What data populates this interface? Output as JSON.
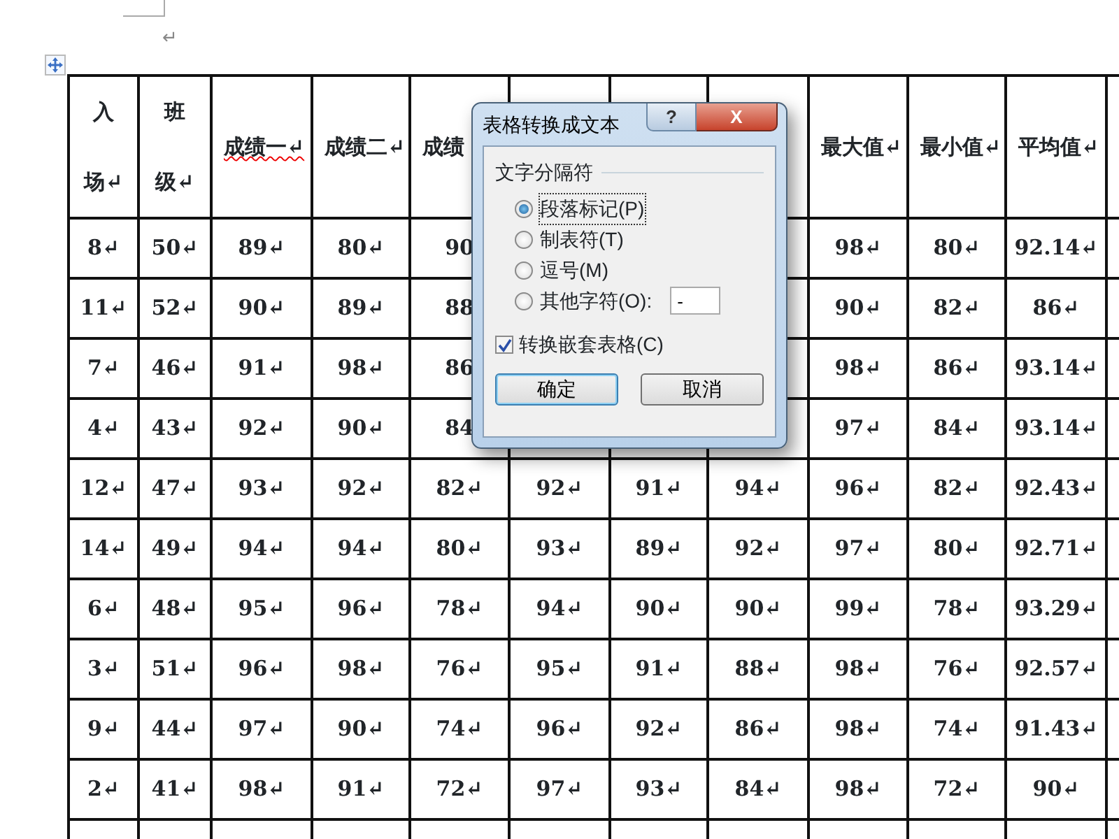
{
  "document": {
    "paragraph_mark": "↵"
  },
  "table": {
    "columns": [
      {
        "label_top": "入",
        "label_bottom": "场↵"
      },
      {
        "label_top": "班",
        "label_bottom": "级↵"
      },
      {
        "label": "成绩一↵",
        "spelling_error": true
      },
      {
        "label": "成绩二↵",
        "spelling_error": false
      },
      {
        "label": "成绩",
        "spelling_error": false
      },
      {},
      {},
      {},
      {
        "label": "最大值↵",
        "spelling_error": false
      },
      {
        "label": "最小值↵",
        "spelling_error": false
      },
      {
        "label": "平均值↵",
        "spelling_error": false
      }
    ],
    "rows": [
      [
        "8↵",
        "50↵",
        "89↵",
        "80↵",
        "90",
        null,
        null,
        null,
        "98↵",
        "80↵",
        "92.14↵"
      ],
      [
        "11↵",
        "52↵",
        "90↵",
        "89↵",
        "88",
        null,
        null,
        null,
        "90↵",
        "82↵",
        "86↵"
      ],
      [
        "7↵",
        "46↵",
        "91↵",
        "98↵",
        "86",
        null,
        null,
        null,
        "98↵",
        "86↵",
        "93.14↵"
      ],
      [
        "4↵",
        "43↵",
        "92↵",
        "90↵",
        "84",
        null,
        null,
        null,
        "97↵",
        "84↵",
        "93.14↵"
      ],
      [
        "12↵",
        "47↵",
        "93↵",
        "92↵",
        "82↵",
        "92↵",
        "91↵",
        "94↵",
        "96↵",
        "82↵",
        "92.43↵"
      ],
      [
        "14↵",
        "49↵",
        "94↵",
        "94↵",
        "80↵",
        "93↵",
        "89↵",
        "92↵",
        "97↵",
        "80↵",
        "92.71↵"
      ],
      [
        "6↵",
        "48↵",
        "95↵",
        "96↵",
        "78↵",
        "94↵",
        "90↵",
        "90↵",
        "99↵",
        "78↵",
        "93.29↵"
      ],
      [
        "3↵",
        "51↵",
        "96↵",
        "98↵",
        "76↵",
        "95↵",
        "91↵",
        "88↵",
        "98↵",
        "76↵",
        "92.57↵"
      ],
      [
        "9↵",
        "44↵",
        "97↵",
        "90↵",
        "74↵",
        "96↵",
        "92↵",
        "86↵",
        "98↵",
        "74↵",
        "91.43↵"
      ],
      [
        "2↵",
        "41↵",
        "98↵",
        "91↵",
        "72↵",
        "97↵",
        "93↵",
        "84↵",
        "98↵",
        "72↵",
        "90↵"
      ],
      [
        null,
        null,
        null,
        null,
        null,
        null,
        null,
        null,
        null,
        null,
        null
      ]
    ]
  },
  "dialog": {
    "title": "表格转换成文本",
    "help": "?",
    "close": "X",
    "group_label": "文字分隔符",
    "options": [
      {
        "label": "段落标记(P)",
        "selected": true,
        "kind": "radio"
      },
      {
        "label": "制表符(T)",
        "selected": false,
        "kind": "radio"
      },
      {
        "label": "逗号(M)",
        "selected": false,
        "kind": "radio"
      },
      {
        "label": "其他字符(O):",
        "selected": false,
        "kind": "radio-field",
        "value": "-"
      }
    ],
    "nested_checkbox": {
      "label": "转换嵌套表格(C)",
      "checked": true
    },
    "buttons": [
      {
        "label": "确定",
        "default": true
      },
      {
        "label": "取消",
        "default": false
      }
    ]
  }
}
